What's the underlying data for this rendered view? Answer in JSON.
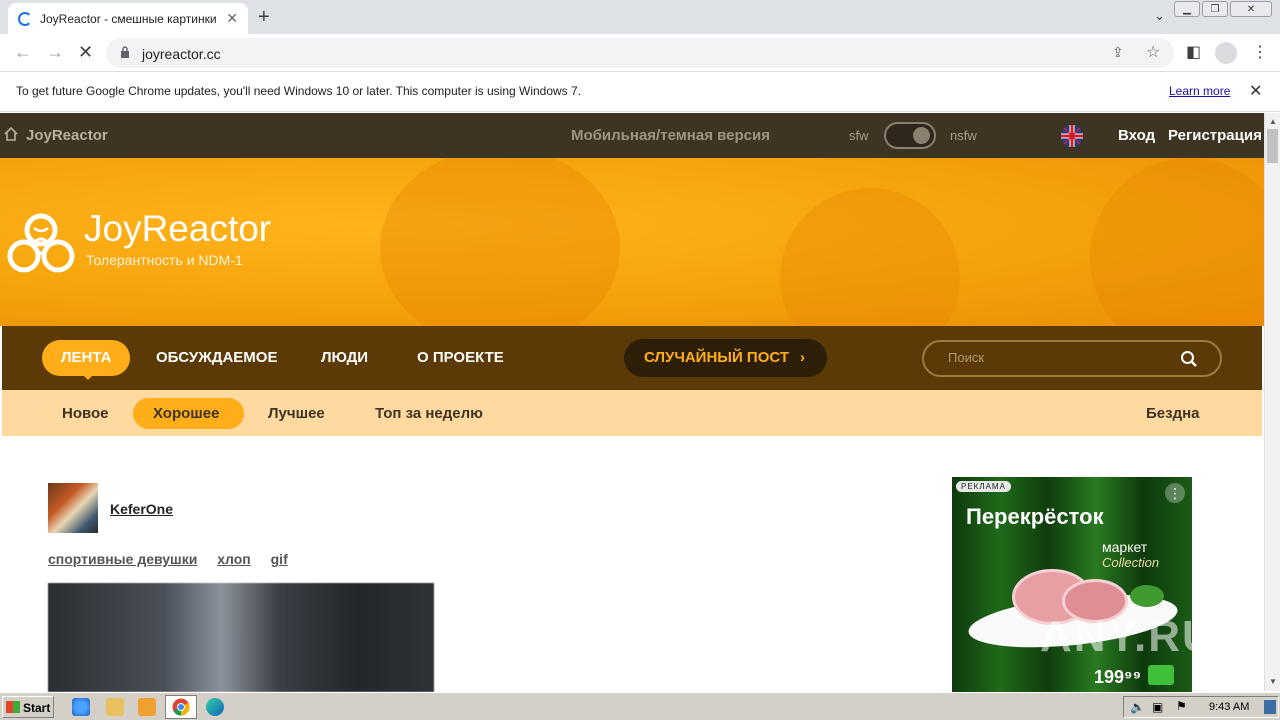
{
  "browser": {
    "tab_title": "JoyReactor - смешные картинки и",
    "url": "joyreactor.cc",
    "infobar_message": "To get future Google Chrome updates, you'll need Windows 10 or later. This computer is using Windows 7.",
    "infobar_link": "Learn more"
  },
  "site": {
    "topnav": {
      "brand": "JoyReactor",
      "mobile_version": "Мобильная/темная версия",
      "sfw": "sfw",
      "nsfw": "nsfw",
      "login": "Вход",
      "register": "Регистрация"
    },
    "banner": {
      "title": "JoyReactor",
      "subtitle": "Толерантность и NDM-1"
    },
    "mainnav": {
      "items": [
        "ЛЕНТА",
        "ОБСУЖДАЕМОЕ",
        "ЛЮДИ",
        "О ПРОЕКТЕ"
      ],
      "random_post": "СЛУЧАЙНЫЙ ПОСТ",
      "search_placeholder": "Поиск"
    },
    "subnav": {
      "items": [
        "Новое",
        "Хорошее",
        "Лучшее",
        "Топ за неделю"
      ],
      "right": "Бездна"
    },
    "post": {
      "username": "KeferOne",
      "tags": [
        "спортивные девушки",
        "хлоп",
        "gif"
      ]
    },
    "ad": {
      "badge": "РЕКЛАМА",
      "brand": "Перекрёсток",
      "market": "маркет",
      "collection": "Collection",
      "price": "199⁹⁹"
    }
  },
  "watermark": "ANY.RUN",
  "taskbar": {
    "start": "Start",
    "clock": "9:43 AM"
  },
  "colors": {
    "accent": "#ffae1a",
    "topnav_bg": "#3e3424",
    "mainnav_bg": "#5b3a07",
    "subnav_bg": "#ffd9a0"
  }
}
